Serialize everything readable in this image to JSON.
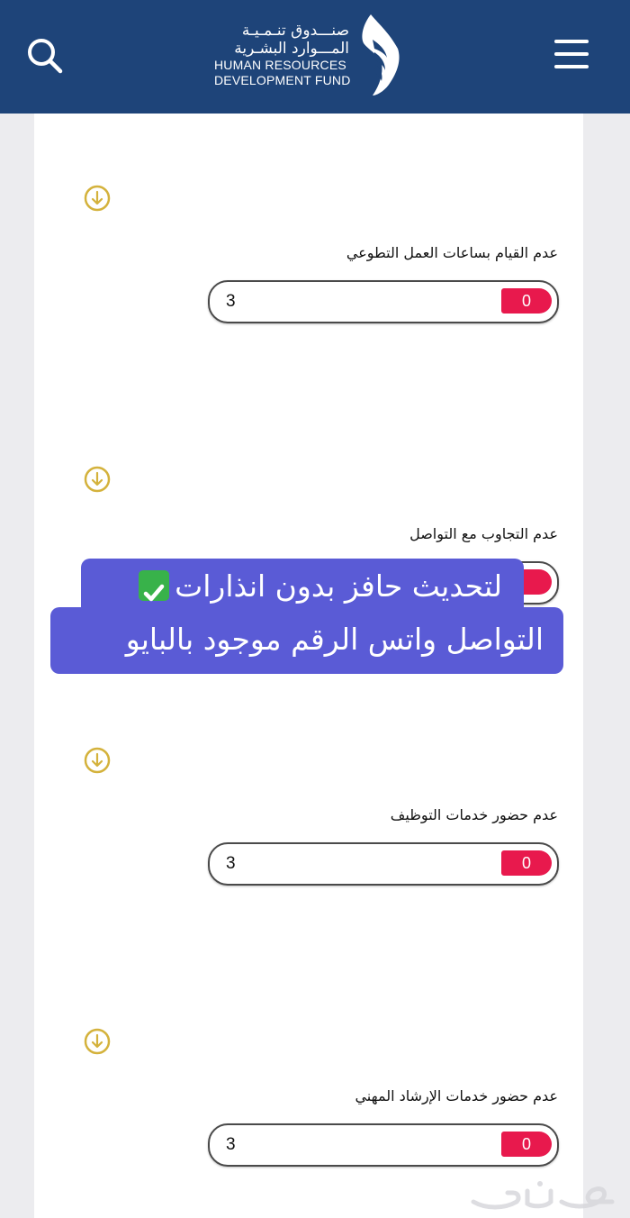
{
  "header": {
    "logo": {
      "arabic_line1": "صنـــدوق تنـمـيـة",
      "arabic_line2": "المـــوارد البشـرية",
      "english_line1": "HUMAN RESOURCES",
      "english_line2": "DEVELOPMENT FUND"
    },
    "icons": {
      "menu": "hamburger-menu-icon",
      "search": "search-icon",
      "logo_mark": "hrdf-logo-mark"
    }
  },
  "items": [
    {
      "label": "عدم القيام بساعات العمل التطوعي",
      "value": "3",
      "badge": "0"
    },
    {
      "label": "عدم التجاوب مع التواصل",
      "value": "",
      "badge": ""
    },
    {
      "label": "عدم حضور خدمات التوظيف",
      "value": "3",
      "badge": "0"
    },
    {
      "label": "عدم حضور خدمات الإرشاد المهني",
      "value": "3",
      "badge": "0"
    }
  ],
  "overlay": {
    "line1": "لتحديث حافز بدون انذارات",
    "line2": "التواصل واتس الرقم موجود بالبايو"
  },
  "colors": {
    "header_bg": "#1e4479",
    "badge": "#e8194d",
    "download_icon": "#d4b23c",
    "overlay_bg": "#5a5bd6",
    "check_green": "#38b24a"
  }
}
